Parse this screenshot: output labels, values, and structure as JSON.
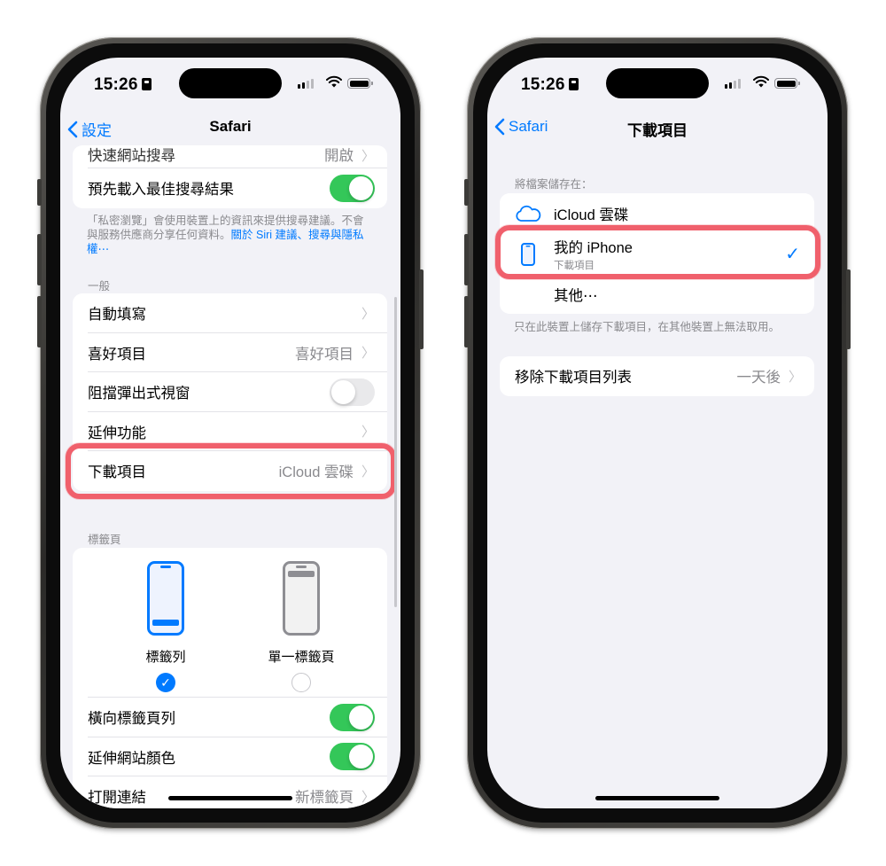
{
  "left_phone": {
    "status": {
      "time": "15:26"
    },
    "nav": {
      "back_label": "設定",
      "title": "Safari"
    },
    "search_group": {
      "partial_label": "快速網站搜尋",
      "partial_value": "開啟",
      "preload_label": "預先載入最佳搜尋結果",
      "preload_on": true
    },
    "search_footer": {
      "text": "「私密瀏覽」會使用裝置上的資訊來提供搜尋建議。不會與服務供應商分享任何資料。",
      "link": "關於 Siri 建議、搜尋與隱私權⋯"
    },
    "general": {
      "header": "一般",
      "autofill_label": "自動填寫",
      "favorites_label": "喜好項目",
      "favorites_value": "喜好項目",
      "popup_label": "阻擋彈出式視窗",
      "popup_on": false,
      "extensions_label": "延伸功能",
      "downloads_label": "下載項目",
      "downloads_value": "iCloud 雲碟"
    },
    "tabs": {
      "header": "標籤頁",
      "tab_bar_label": "標籤列",
      "single_tab_label": "單一標籤頁",
      "selected": "標籤列",
      "landscape_label": "橫向標籤頁列",
      "landscape_on": true,
      "tint_label": "延伸網站顏色",
      "tint_on": true,
      "open_links_label": "打開連結",
      "open_links_value": "新標籤頁"
    }
  },
  "right_phone": {
    "status": {
      "time": "15:26"
    },
    "nav": {
      "back_label": "Safari",
      "title": "下載項目"
    },
    "storage": {
      "header": "將檔案儲存在：",
      "icloud_label": "iCloud 雲碟",
      "on_iphone_label": "我的 iPhone",
      "on_iphone_sub": "下載項目",
      "selected": "我的 iPhone",
      "other_label": "其他⋯"
    },
    "storage_footer": "只在此裝置上儲存下載項目，在其他裝置上無法取用。",
    "remove": {
      "label": "移除下載項目列表",
      "value": "一天後"
    }
  },
  "colors": {
    "accent": "#007aff",
    "toggle_on": "#34c759",
    "highlight": "#f0606c",
    "background": "#f2f2f7"
  }
}
